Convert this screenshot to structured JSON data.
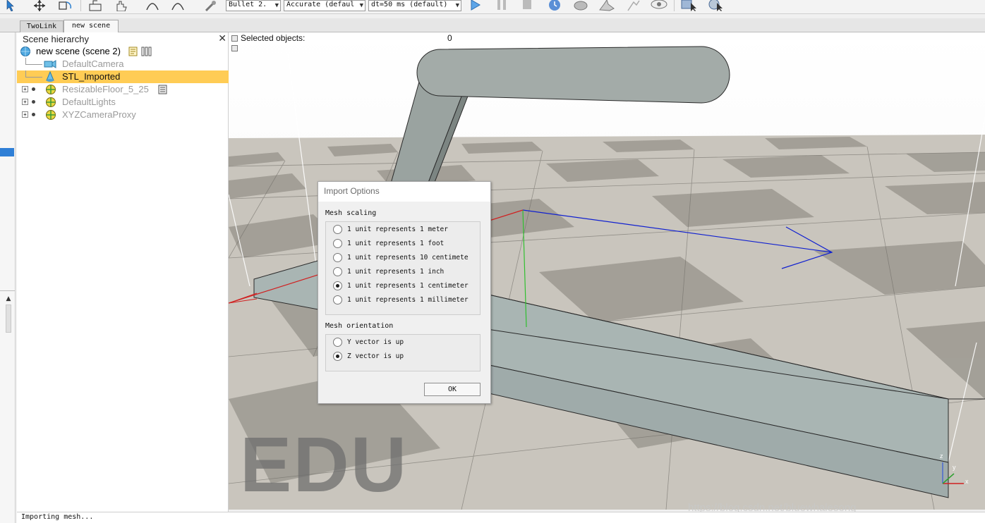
{
  "toolbar": {
    "engine": "Bullet 2.",
    "accuracy": "Accurate (defaul",
    "timestep": "dt=50 ms (default)"
  },
  "tabs": [
    "TwoLink",
    "new scene"
  ],
  "hierarchy": {
    "title": "Scene hierarchy",
    "items": [
      {
        "label": "new scene (scene 2)"
      },
      {
        "label": "DefaultCamera"
      },
      {
        "label": "STL_Imported"
      },
      {
        "label": "ResizableFloor_5_25"
      },
      {
        "label": "DefaultLights"
      },
      {
        "label": "XYZCameraProxy"
      }
    ]
  },
  "viewport": {
    "selected_label": "Selected objects:",
    "selected_count": "0",
    "edu_watermark": "EDU",
    "url_watermark": "https://blog.csdn.net/bluewhalesong"
  },
  "dialog": {
    "title": "Import Options",
    "scaling_label": "Mesh scaling",
    "scaling_options": [
      {
        "label": "1 unit represents 1 meter",
        "selected": false
      },
      {
        "label": "1 unit represents 1 foot",
        "selected": false
      },
      {
        "label": "1 unit represents 10 centimete",
        "selected": false
      },
      {
        "label": "1 unit represents 1 inch",
        "selected": false
      },
      {
        "label": "1 unit represents 1 centimeter",
        "selected": true
      },
      {
        "label": "1 unit represents 1 millimeter",
        "selected": false
      }
    ],
    "orientation_label": "Mesh orientation",
    "orientation_options": [
      {
        "label": "Y vector is up",
        "selected": false
      },
      {
        "label": "Z vector is up",
        "selected": true
      }
    ],
    "ok_label": "OK"
  },
  "status": {
    "text": "Importing mesh..."
  },
  "colors": {
    "selection": "#ffcc55",
    "floor_dark": "#9a968e",
    "floor_light": "#d8d4cc",
    "shape": "#a7b2b0"
  }
}
